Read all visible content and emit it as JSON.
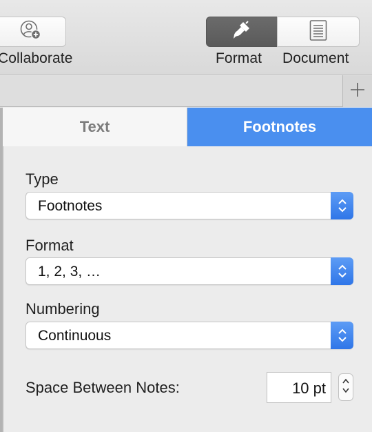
{
  "toolbar": {
    "collaborate_label": "Collaborate",
    "format_label": "Format",
    "document_label": "Document",
    "collaborate_icon": "person-add-icon",
    "format_icon": "paintbrush-icon",
    "document_icon": "document-icon",
    "selected": "Format"
  },
  "tabstrip": {
    "add_icon": "plus-icon"
  },
  "inspector": {
    "tabs": [
      {
        "label": "Text",
        "selected": false
      },
      {
        "label": "Footnotes",
        "selected": true
      }
    ],
    "type": {
      "label": "Type",
      "value": "Footnotes"
    },
    "format": {
      "label": "Format",
      "value": "1, 2, 3, …"
    },
    "numbering": {
      "label": "Numbering",
      "value": "Continuous"
    },
    "space_between": {
      "label": "Space Between Notes:",
      "value": "10 pt"
    }
  },
  "colors": {
    "accent": "#4a8fef",
    "selected_segment": "#626262",
    "background": "#ececec"
  }
}
